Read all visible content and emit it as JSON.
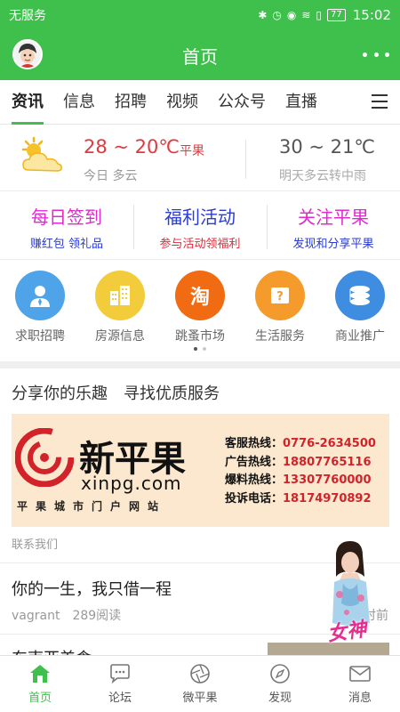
{
  "status_bar": {
    "carrier": "无服务",
    "battery": "77",
    "time": "15:02"
  },
  "header": {
    "title": "首页"
  },
  "tabs": [
    {
      "label": "资讯",
      "active": true
    },
    {
      "label": "信息"
    },
    {
      "label": "招聘"
    },
    {
      "label": "视频"
    },
    {
      "label": "公众号"
    },
    {
      "label": "直播"
    }
  ],
  "weather": {
    "today_temp": "28 ~ 20℃",
    "city": "平果",
    "today_desc": "今日 多云",
    "tomorrow_temp": "30 ~ 21℃",
    "tomorrow_desc": "明天多云转中雨"
  },
  "promos": [
    {
      "title": "每日签到",
      "subtitle": "赚红包 领礼品",
      "title_color": "#e02ad0",
      "subtitle_color": "#2a3bd6"
    },
    {
      "title": "福利活动",
      "subtitle": "参与活动领福利",
      "title_color": "#2a3bd6",
      "subtitle_color": "#e02a3a"
    },
    {
      "title": "关注平果",
      "subtitle": "发现和分享平果",
      "title_color": "#e02ad0",
      "subtitle_color": "#2a3bd6"
    }
  ],
  "services": [
    {
      "label": "求职招聘",
      "icon": "job-person-icon",
      "color": "#4fa3e8"
    },
    {
      "label": "房源信息",
      "icon": "building-icon",
      "color": "#f2cc3a"
    },
    {
      "label": "跳蚤市场",
      "icon": "tao-icon",
      "glyph": "淘",
      "color": "#f06b12"
    },
    {
      "label": "生活服务",
      "icon": "life-service-icon",
      "color": "#f59b2b"
    },
    {
      "label": "商业推广",
      "icon": "coins-icon",
      "color": "#3f8de0"
    }
  ],
  "section": {
    "title": "分享你的乐趣　寻找优质服务"
  },
  "banner": {
    "brand": "新平果",
    "domain": "xinpg.com",
    "tagline": "平果城市门户网站",
    "hotlines": [
      {
        "label": "客服热线：",
        "number": "0776-2634500"
      },
      {
        "label": "广告热线：",
        "number": "18807765116"
      },
      {
        "label": "爆料热线：",
        "number": "13307760000"
      },
      {
        "label": "投诉电话：",
        "number": "18174970892"
      }
    ]
  },
  "contact": "联系我们",
  "articles": [
    {
      "title": "你的一生，我只借一程",
      "author": "vagrant",
      "reads": "289阅读",
      "time": "时前"
    },
    {
      "title": "东南亚美食"
    }
  ],
  "floating": {
    "label": "女神"
  },
  "bottom_nav": [
    {
      "label": "首页",
      "icon": "home-icon",
      "active": true
    },
    {
      "label": "论坛",
      "icon": "chat-bubble-icon"
    },
    {
      "label": "微平果",
      "icon": "aperture-icon"
    },
    {
      "label": "发现",
      "icon": "compass-icon"
    },
    {
      "label": "消息",
      "icon": "mail-icon"
    }
  ]
}
